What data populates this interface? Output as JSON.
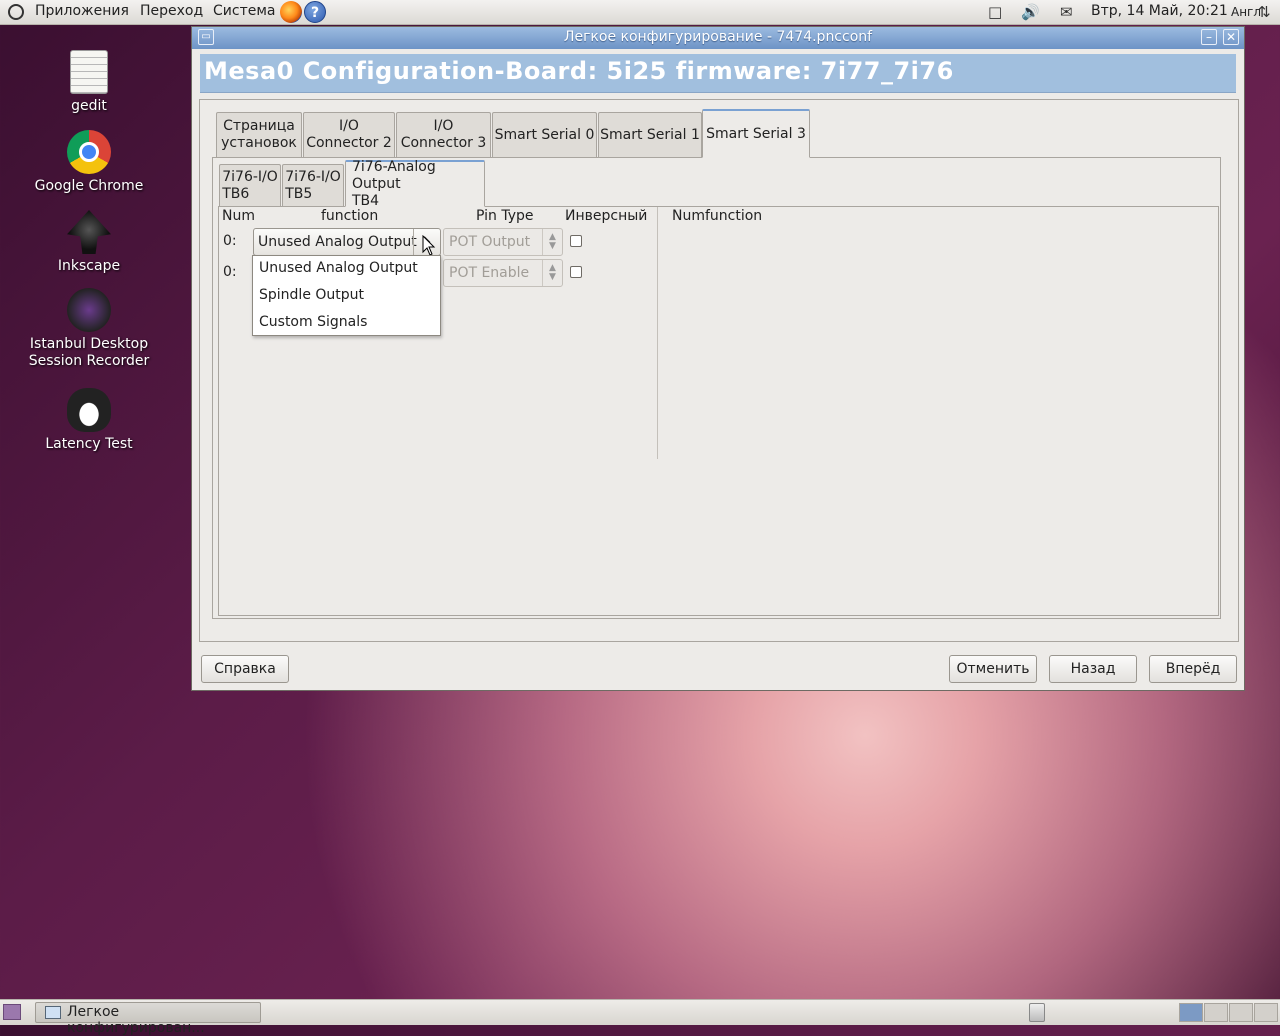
{
  "top_panel": {
    "menu_apps": "Приложения",
    "menu_go": "Переход",
    "menu_system": "Система",
    "help_glyph": "?",
    "datetime": "Втр, 14 Май, 20:21",
    "keyboard_layout": "Англ"
  },
  "desktop": {
    "icons": [
      {
        "label": "gedit",
        "icon": "gedit-icon"
      },
      {
        "label": "Google Chrome",
        "icon": "chrome-icon"
      },
      {
        "label": "Inkscape",
        "icon": "inkscape-icon"
      },
      {
        "label": "Istanbul Desktop\nSession Recorder",
        "icon": "istanbul-icon"
      },
      {
        "label": "Latency Test",
        "icon": "tux-icon"
      }
    ]
  },
  "window": {
    "title": "Легкое конфигурирование - 7474.pncconf",
    "header": "Mesa0 Configuration-Board: 5i25 firmware: 7i77_7i76",
    "tabs": [
      {
        "label": "Страница\nустановок"
      },
      {
        "label": "I/O\nConnector 2"
      },
      {
        "label": "I/O\nConnector 3"
      },
      {
        "label": "Smart Serial 0"
      },
      {
        "label": "Smart Serial 1"
      },
      {
        "label": "Smart Serial 3",
        "active": true
      }
    ],
    "subtabs": [
      {
        "label": "7i76-I/O\nTB6"
      },
      {
        "label": "7i76-I/O\nTB5"
      },
      {
        "label": "7i76-Analog Output\nTB4",
        "active": true
      }
    ],
    "columns": {
      "num": "Num",
      "function": "function",
      "pin_type": "Pin Type",
      "inverse": "Инверсный",
      "numfunction": "Numfunction"
    },
    "rows": [
      {
        "num": "0:",
        "function": "Unused Analog Output",
        "pin_type": "POT Output",
        "inverted": false
      },
      {
        "num": "0:",
        "function": "",
        "pin_type": "POT Enable",
        "inverted": false
      }
    ],
    "dropdown_options": [
      "Unused Analog Output",
      "Spindle Output",
      "Custom Signals"
    ],
    "buttons": {
      "help": "Справка",
      "cancel": "Отменить",
      "back": "Назад",
      "forward": "Вперёд"
    }
  },
  "bottom_panel": {
    "task_label": "Легкое конфигурирован..."
  }
}
